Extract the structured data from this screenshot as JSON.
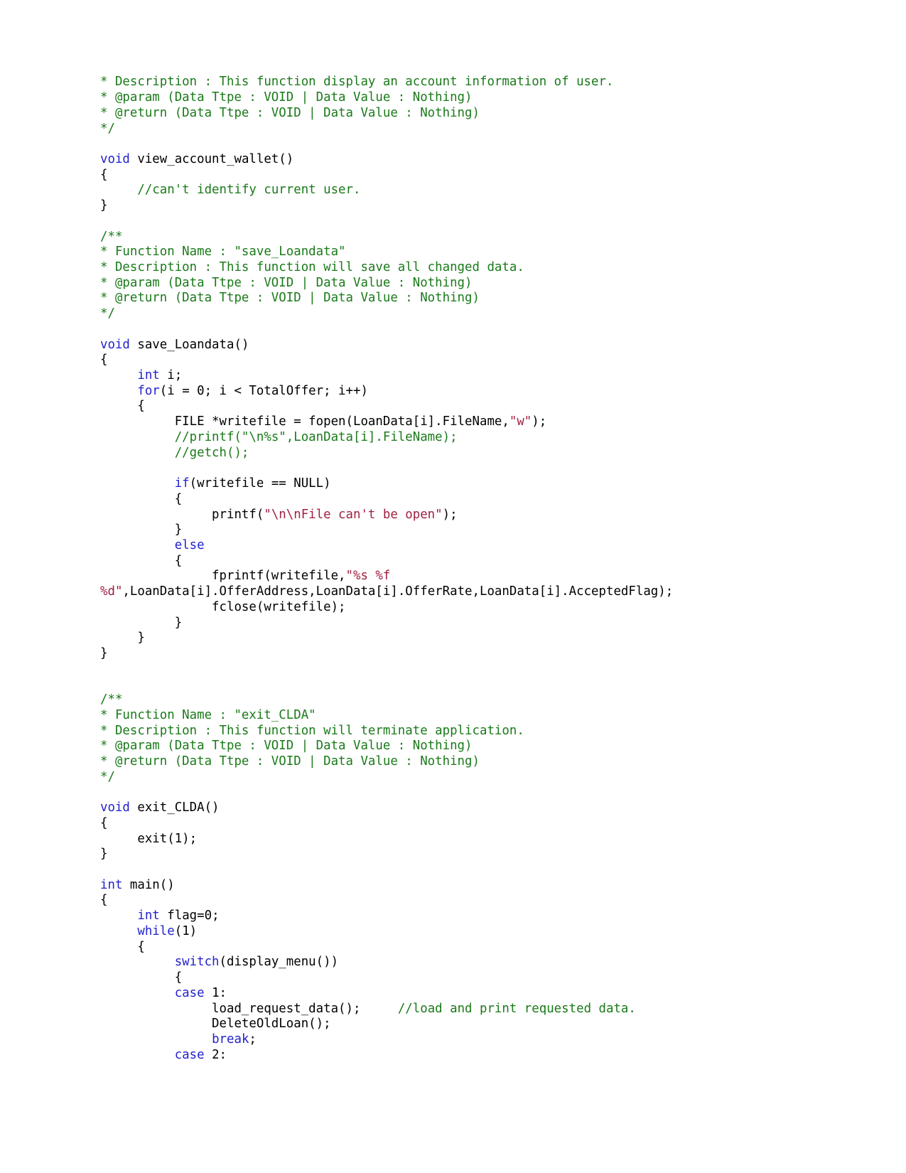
{
  "document": {
    "kind": "source-code-listing",
    "language": "C",
    "page_background": "#ffffff",
    "colors": {
      "comment": "#1a7a1a",
      "keyword": "#2222cc",
      "string": "#a02040",
      "plain": "#000000"
    }
  },
  "code": {
    "lines": [
      [
        {
          "t": "* Description : This function display an account information of user.",
          "c": "cm"
        }
      ],
      [
        {
          "t": "* @param (Data Ttpe : VOID | Data Value : Nothing)",
          "c": "cm"
        }
      ],
      [
        {
          "t": "* @return (Data Ttpe : VOID | Data Value : Nothing)",
          "c": "cm"
        }
      ],
      [
        {
          "t": "*/",
          "c": "cm"
        }
      ],
      [
        {
          "t": "",
          "c": "pl"
        }
      ],
      [
        {
          "t": "void",
          "c": "kw"
        },
        {
          "t": " view_account_wallet()",
          "c": "pl"
        }
      ],
      [
        {
          "t": "{",
          "c": "pl"
        }
      ],
      [
        {
          "t": "     ",
          "c": "pl"
        },
        {
          "t": "//can't identify current user.",
          "c": "cm"
        }
      ],
      [
        {
          "t": "}",
          "c": "pl"
        }
      ],
      [
        {
          "t": "",
          "c": "pl"
        }
      ],
      [
        {
          "t": "/**",
          "c": "cm"
        }
      ],
      [
        {
          "t": "* Function Name : \"save_Loandata\"",
          "c": "cm"
        }
      ],
      [
        {
          "t": "* Description : This function will save all changed data.",
          "c": "cm"
        }
      ],
      [
        {
          "t": "* @param (Data Ttpe : VOID | Data Value : Nothing)",
          "c": "cm"
        }
      ],
      [
        {
          "t": "* @return (Data Ttpe : VOID | Data Value : Nothing)",
          "c": "cm"
        }
      ],
      [
        {
          "t": "*/",
          "c": "cm"
        }
      ],
      [
        {
          "t": "",
          "c": "pl"
        }
      ],
      [
        {
          "t": "void",
          "c": "kw"
        },
        {
          "t": " save_Loandata()",
          "c": "pl"
        }
      ],
      [
        {
          "t": "{",
          "c": "pl"
        }
      ],
      [
        {
          "t": "     ",
          "c": "pl"
        },
        {
          "t": "int",
          "c": "kw"
        },
        {
          "t": " i;",
          "c": "pl"
        }
      ],
      [
        {
          "t": "     ",
          "c": "pl"
        },
        {
          "t": "for",
          "c": "kw"
        },
        {
          "t": "(i = 0; i < TotalOffer; i++)",
          "c": "pl"
        }
      ],
      [
        {
          "t": "     {",
          "c": "pl"
        }
      ],
      [
        {
          "t": "          FILE *writefile = fopen(LoanData[i].FileName,",
          "c": "pl"
        },
        {
          "t": "\"w\"",
          "c": "st"
        },
        {
          "t": ");",
          "c": "pl"
        }
      ],
      [
        {
          "t": "          ",
          "c": "pl"
        },
        {
          "t": "//printf(\"\\n%s\",LoanData[i].FileName);",
          "c": "cm"
        }
      ],
      [
        {
          "t": "          ",
          "c": "pl"
        },
        {
          "t": "//getch();",
          "c": "cm"
        }
      ],
      [
        {
          "t": "",
          "c": "pl"
        }
      ],
      [
        {
          "t": "          ",
          "c": "pl"
        },
        {
          "t": "if",
          "c": "kw"
        },
        {
          "t": "(writefile == NULL)",
          "c": "pl"
        }
      ],
      [
        {
          "t": "          {",
          "c": "pl"
        }
      ],
      [
        {
          "t": "               printf(",
          "c": "pl"
        },
        {
          "t": "\"\\n\\nFile can't be open\"",
          "c": "st"
        },
        {
          "t": ");",
          "c": "pl"
        }
      ],
      [
        {
          "t": "          }",
          "c": "pl"
        }
      ],
      [
        {
          "t": "          ",
          "c": "pl"
        },
        {
          "t": "else",
          "c": "kw"
        }
      ],
      [
        {
          "t": "          {",
          "c": "pl"
        }
      ],
      [
        {
          "t": "               fprintf(writefile,",
          "c": "pl"
        },
        {
          "t": "\"%s %f",
          "c": "st"
        }
      ],
      [
        {
          "t": "%d\"",
          "c": "st"
        },
        {
          "t": ",LoanData[i].OfferAddress,LoanData[i].OfferRate,LoanData[i].AcceptedFlag);",
          "c": "pl"
        }
      ],
      [
        {
          "t": "               fclose(writefile);",
          "c": "pl"
        }
      ],
      [
        {
          "t": "          }",
          "c": "pl"
        }
      ],
      [
        {
          "t": "     }",
          "c": "pl"
        }
      ],
      [
        {
          "t": "}",
          "c": "pl"
        }
      ],
      [
        {
          "t": "",
          "c": "pl"
        }
      ],
      [
        {
          "t": "",
          "c": "pl"
        }
      ],
      [
        {
          "t": "/**",
          "c": "cm"
        }
      ],
      [
        {
          "t": "* Function Name : \"exit_CLDA\"",
          "c": "cm"
        }
      ],
      [
        {
          "t": "* Description : This function will terminate application.",
          "c": "cm"
        }
      ],
      [
        {
          "t": "* @param (Data Ttpe : VOID | Data Value : Nothing)",
          "c": "cm"
        }
      ],
      [
        {
          "t": "* @return (Data Ttpe : VOID | Data Value : Nothing)",
          "c": "cm"
        }
      ],
      [
        {
          "t": "*/",
          "c": "cm"
        }
      ],
      [
        {
          "t": "",
          "c": "pl"
        }
      ],
      [
        {
          "t": "void",
          "c": "kw"
        },
        {
          "t": " exit_CLDA()",
          "c": "pl"
        }
      ],
      [
        {
          "t": "{",
          "c": "pl"
        }
      ],
      [
        {
          "t": "     exit(1);",
          "c": "pl"
        }
      ],
      [
        {
          "t": "}",
          "c": "pl"
        }
      ],
      [
        {
          "t": "",
          "c": "pl"
        }
      ],
      [
        {
          "t": "int",
          "c": "kw"
        },
        {
          "t": " main()",
          "c": "pl"
        }
      ],
      [
        {
          "t": "{",
          "c": "pl"
        }
      ],
      [
        {
          "t": "     ",
          "c": "pl"
        },
        {
          "t": "int",
          "c": "kw"
        },
        {
          "t": " flag=0;",
          "c": "pl"
        }
      ],
      [
        {
          "t": "     ",
          "c": "pl"
        },
        {
          "t": "while",
          "c": "kw"
        },
        {
          "t": "(1)",
          "c": "pl"
        }
      ],
      [
        {
          "t": "     {",
          "c": "pl"
        }
      ],
      [
        {
          "t": "          ",
          "c": "pl"
        },
        {
          "t": "switch",
          "c": "kw"
        },
        {
          "t": "(display_menu())",
          "c": "pl"
        }
      ],
      [
        {
          "t": "          {",
          "c": "pl"
        }
      ],
      [
        {
          "t": "          ",
          "c": "pl"
        },
        {
          "t": "case",
          "c": "kw"
        },
        {
          "t": " 1:",
          "c": "pl"
        }
      ],
      [
        {
          "t": "               load_request_data();     ",
          "c": "pl"
        },
        {
          "t": "//load and print requested data.",
          "c": "cm"
        }
      ],
      [
        {
          "t": "               DeleteOldLoan();",
          "c": "pl"
        }
      ],
      [
        {
          "t": "               ",
          "c": "pl"
        },
        {
          "t": "break",
          "c": "kw"
        },
        {
          "t": ";",
          "c": "pl"
        }
      ],
      [
        {
          "t": "          ",
          "c": "pl"
        },
        {
          "t": "case",
          "c": "kw"
        },
        {
          "t": " 2:",
          "c": "pl"
        }
      ]
    ]
  }
}
